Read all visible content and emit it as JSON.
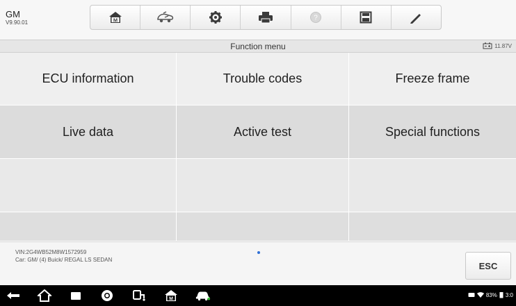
{
  "header": {
    "brand": "GM",
    "version": "V9.90.01",
    "toolbar": [
      {
        "icon": "home-icon"
      },
      {
        "icon": "vehicle-swap-icon"
      },
      {
        "icon": "settings-icon"
      },
      {
        "icon": "print-icon"
      },
      {
        "icon": "help-icon"
      },
      {
        "icon": "save-icon"
      },
      {
        "icon": "edit-icon"
      }
    ]
  },
  "titlebar": {
    "title": "Function menu",
    "voltage": "11.87V"
  },
  "menu": {
    "items": [
      {
        "label": "ECU information"
      },
      {
        "label": "Trouble codes"
      },
      {
        "label": "Freeze frame"
      },
      {
        "label": "Live data"
      },
      {
        "label": "Active test"
      },
      {
        "label": "Special functions"
      }
    ]
  },
  "footer": {
    "vin": "VIN:2G4WB52M8W1572959",
    "car": "Car: GM/ (4) Buick/ REGAL LS SEDAN",
    "esc_label": "ESC"
  },
  "status": {
    "battery": "83%",
    "time": "3:0"
  },
  "colors": {
    "accent": "#2f6fd6",
    "nav_background": "#000000"
  }
}
